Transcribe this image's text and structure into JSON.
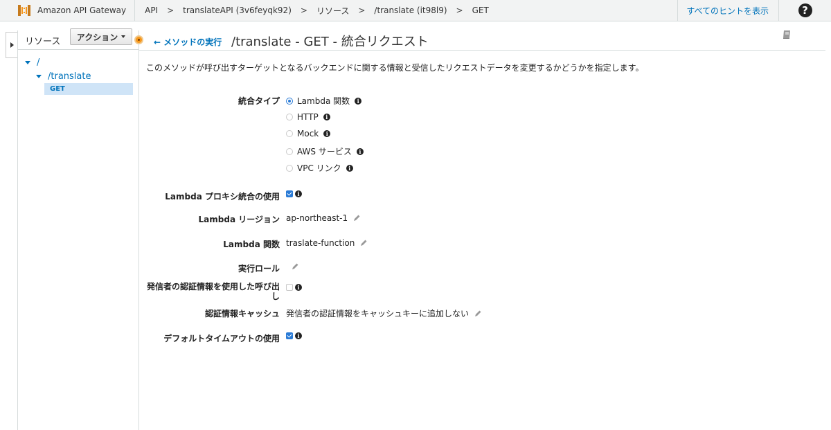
{
  "topbar": {
    "brand": "Amazon API Gateway",
    "breadcrumbs": [
      "API",
      "translateAPI (3v6feyqk92)",
      "リソース",
      "/translate (it98l9)",
      "GET"
    ],
    "separator": ">",
    "hints_link": "すべてのヒントを表示",
    "help_symbol": "?"
  },
  "resources": {
    "title": "リソース",
    "action_button": "アクション",
    "tree": [
      {
        "label": "/"
      },
      {
        "label": "/translate"
      },
      {
        "label": "GET",
        "selected": true
      }
    ]
  },
  "main": {
    "back_link": "メソッドの実行",
    "back_arrow": "←",
    "title": "/translate - GET - 統合リクエスト",
    "description": "このメソッドが呼び出すターゲットとなるバックエンドに関する情報と受信したリクエストデータを変更するかどうかを指定します。"
  },
  "form": {
    "integration_type": {
      "label": "統合タイプ",
      "options": [
        {
          "label": "Lambda 関数",
          "selected": true
        },
        {
          "label": "HTTP",
          "selected": false
        },
        {
          "label": "Mock",
          "selected": false
        },
        {
          "label": "AWS サービス",
          "selected": false
        },
        {
          "label": "VPC リンク",
          "selected": false
        }
      ]
    },
    "proxy": {
      "label": "Lambda プロキシ統合の使用",
      "checked": true
    },
    "region": {
      "label": "Lambda リージョン",
      "value": "ap-northeast-1"
    },
    "function": {
      "label": "Lambda 関数",
      "value": "traslate-function"
    },
    "exec_role": {
      "label": "実行ロール",
      "value": ""
    },
    "caller_credentials": {
      "label_line1": "発信者の認証情報を使用した呼び出",
      "label_line2": "し",
      "checked": false
    },
    "credentials_cache": {
      "label": "認証情報キャッシュ",
      "value": "発信者の認証情報をキャッシュキーに追加しない"
    },
    "default_timeout": {
      "label": "デフォルトタイムアウトの使用",
      "checked": true
    }
  },
  "colors": {
    "link": "#0073bb",
    "accent": "#2a7bd6",
    "orange": "#f7981d"
  },
  "icons": [
    "api-gateway-logo-icon",
    "help-icon",
    "expand-panel-icon",
    "chevron-down-icon",
    "dropdown-caret-icon",
    "book-icon",
    "info-icon",
    "pencil-icon",
    "radio-icon",
    "checkbox-icon"
  ]
}
